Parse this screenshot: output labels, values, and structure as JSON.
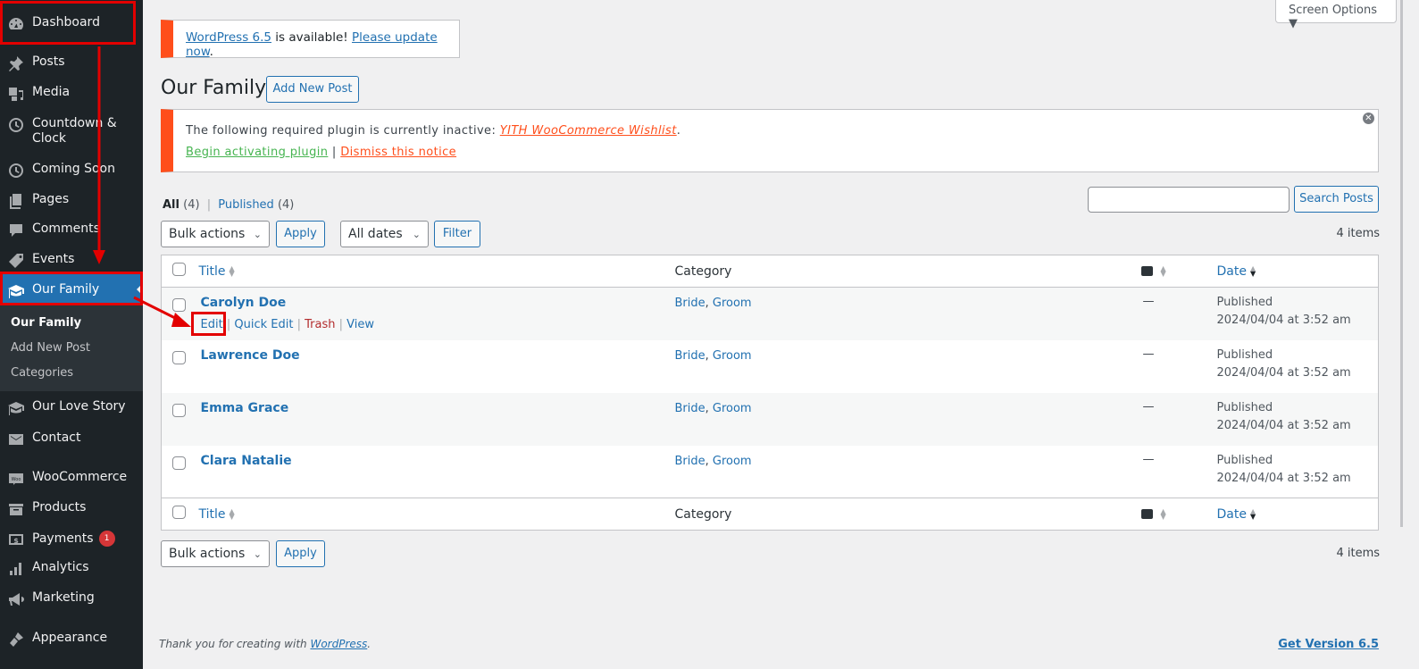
{
  "sidebar": {
    "items": [
      {
        "label": "Dashboard",
        "icon": "dashboard-icon"
      },
      {
        "label": "Posts",
        "icon": "pin-icon"
      },
      {
        "label": "Media",
        "icon": "media-icon"
      },
      {
        "label": "Countdown & Clock",
        "icon": "clock-icon"
      },
      {
        "label": "Coming Soon",
        "icon": "clock-icon"
      },
      {
        "label": "Pages",
        "icon": "pages-icon"
      },
      {
        "label": "Comments",
        "icon": "comment-icon"
      },
      {
        "label": "Events",
        "icon": "tag-icon"
      },
      {
        "label": "Our Family",
        "icon": "graduation-cap-icon",
        "active": true
      },
      {
        "label": "Our Love Story",
        "icon": "graduation-cap-icon"
      },
      {
        "label": "Contact",
        "icon": "envelope-icon"
      },
      {
        "label": "WooCommerce",
        "icon": "woo-icon"
      },
      {
        "label": "Products",
        "icon": "archive-icon"
      },
      {
        "label": "Payments",
        "icon": "dollar-icon",
        "badge": "1"
      },
      {
        "label": "Analytics",
        "icon": "bar-chart-icon"
      },
      {
        "label": "Marketing",
        "icon": "megaphone-icon"
      },
      {
        "label": "Appearance",
        "icon": "brush-icon"
      }
    ],
    "submenu": [
      {
        "label": "Our Family",
        "current": true
      },
      {
        "label": "Add New Post"
      },
      {
        "label": "Categories"
      }
    ]
  },
  "header": {
    "screen_options": "Screen Options ▼",
    "update_notice": {
      "link1": "WordPress 6.5",
      "middle": " is available! ",
      "link2": "Please update now",
      "end": "."
    },
    "page_title": "Our Family",
    "add_new": "Add New Post"
  },
  "plugin_notice": {
    "text": "The following required plugin is currently inactive: ",
    "plugin": "YITH WooCommerce Wishlist",
    "period": ".",
    "activate": "Begin activating plugin",
    "sep": " | ",
    "dismiss": "Dismiss this notice",
    "close": "✕"
  },
  "filters": {
    "all_label": "All",
    "all_count": "(4)",
    "sep": "|",
    "published_label": "Published",
    "published_count": "(4)",
    "bulk_actions": "Bulk actions",
    "apply": "Apply",
    "dates": "All dates",
    "filter": "Filter",
    "search_placeholder": "",
    "search_button": "Search Posts",
    "items_count": "4 items"
  },
  "table": {
    "columns": {
      "title": "Title",
      "category": "Category",
      "date": "Date"
    },
    "row_actions": {
      "edit": "Edit",
      "quick_edit": "Quick Edit",
      "trash": "Trash",
      "view": "View",
      "sep": "|"
    },
    "rows": [
      {
        "title": "Carolyn Doe",
        "cat1": "Bride",
        "cat2": "Groom",
        "comments": "—",
        "status": "Published",
        "date": "2024/04/04 at 3:52 am"
      },
      {
        "title": "Lawrence Doe",
        "cat1": "Bride",
        "cat2": "Groom",
        "comments": "—",
        "status": "Published",
        "date": "2024/04/04 at 3:52 am"
      },
      {
        "title": "Emma Grace",
        "cat1": "Bride",
        "cat2": "Groom",
        "comments": "—",
        "status": "Published",
        "date": "2024/04/04 at 3:52 am"
      },
      {
        "title": "Clara Natalie",
        "cat1": "Bride",
        "cat2": "Groom",
        "comments": "—",
        "status": "Published",
        "date": "2024/04/04 at 3:52 am"
      }
    ]
  },
  "footer": {
    "thanks": "Thank you for creating with ",
    "wp_link": "WordPress",
    "period": ".",
    "get_version": "Get Version 6.5"
  },
  "colors": {
    "sidebar_bg": "#1d2327",
    "active_bg": "#2271b1",
    "link": "#2271b1",
    "notice_accent": "#ff4e1b",
    "annotation": "#e30000",
    "badge": "#d63638"
  }
}
